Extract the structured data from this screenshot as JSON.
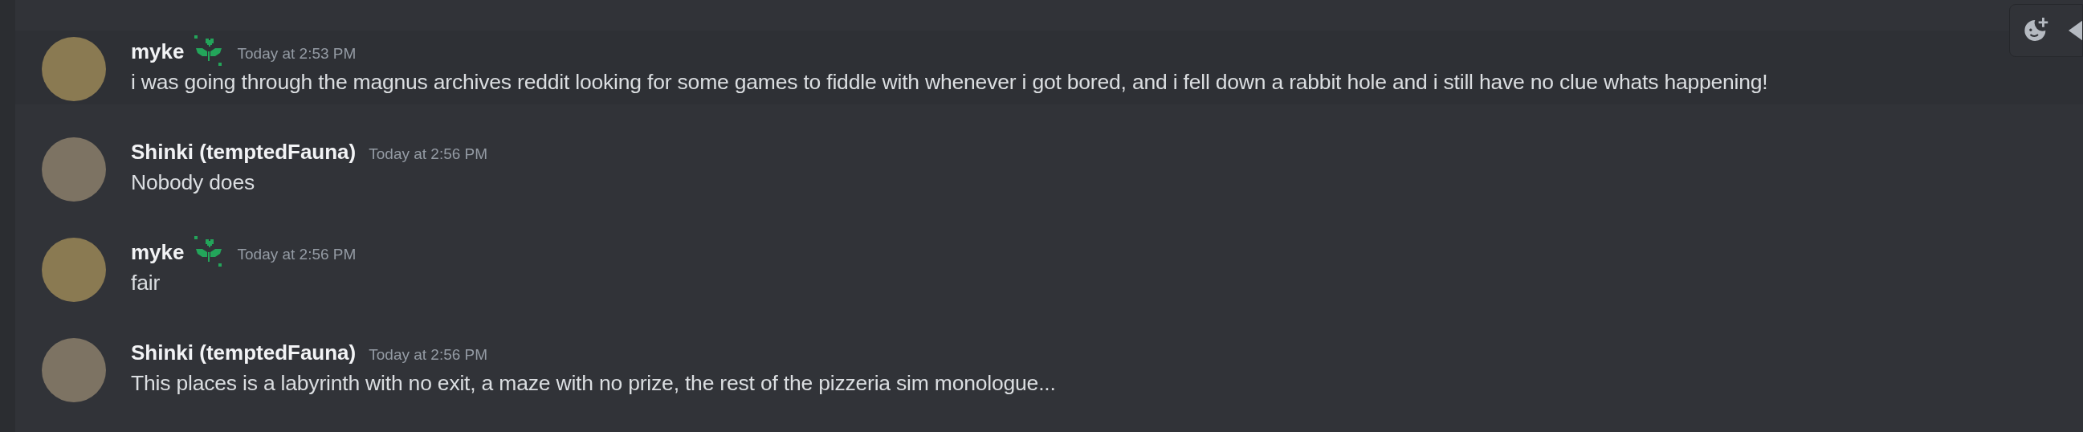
{
  "messages": [
    {
      "author": "myke",
      "badge": true,
      "timestamp": "Today at 2:53 PM",
      "text": "i was going through the magnus archives reddit looking for some games to fiddle with whenever i got bored, and i fell down a rabbit hole and i still have no clue whats happening!",
      "hovered": true
    },
    {
      "author": "Shinki (temptedFauna)",
      "badge": false,
      "timestamp": "Today at 2:56 PM",
      "text": "Nobody does",
      "hovered": false
    },
    {
      "author": "myke",
      "badge": true,
      "timestamp": "Today at 2:56 PM",
      "text": "fair",
      "hovered": false
    },
    {
      "author": "Shinki (temptedFauna)",
      "badge": false,
      "timestamp": "Today at 2:56 PM",
      "text": "This places is a labyrinth with no exit, a maze with no prize, the rest of the pizzeria sim monologue...",
      "hovered": false
    }
  ]
}
